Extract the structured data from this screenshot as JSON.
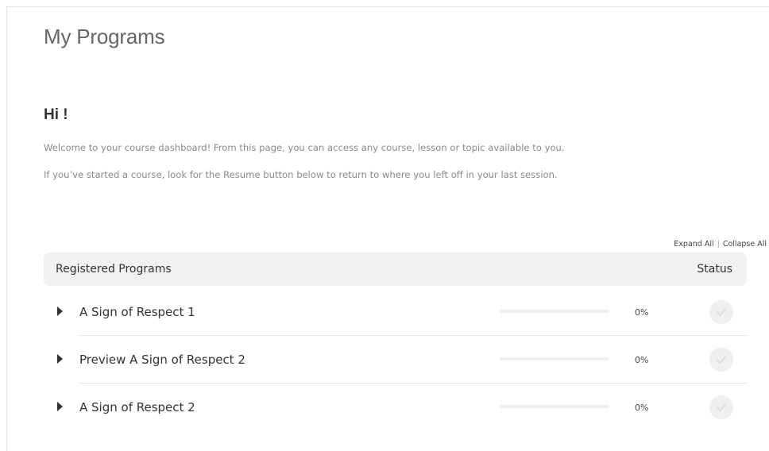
{
  "page": {
    "title": "My Programs",
    "greeting": "Hi !",
    "intro_lines": [
      "Welcome to your course dashboard!  From this page, you can access any course, lesson or topic available to you.",
      "If you’ve started a course, look for the Resume button below to return to where you left off in your last session."
    ]
  },
  "controls": {
    "expand_all": "Expand All",
    "separator": "|",
    "collapse_all": "Collapse All"
  },
  "table": {
    "header_name": "Registered Programs",
    "header_status": "Status",
    "rows": [
      {
        "title": "A Sign of Respect 1",
        "progress": 0,
        "progress_label": "0%",
        "status_icon": "check-circle-icon"
      },
      {
        "title": "Preview A Sign of Respect 2",
        "progress": 0,
        "progress_label": "0%",
        "status_icon": "check-circle-icon"
      },
      {
        "title": "A Sign of Respect 2",
        "progress": 0,
        "progress_label": "0%",
        "status_icon": "check-circle-icon"
      }
    ]
  },
  "colors": {
    "header_bg": "#f1f1f1",
    "progress_track": "#efefef",
    "status_icon_bg": "#efefef",
    "status_check": "#dcdcdc"
  }
}
